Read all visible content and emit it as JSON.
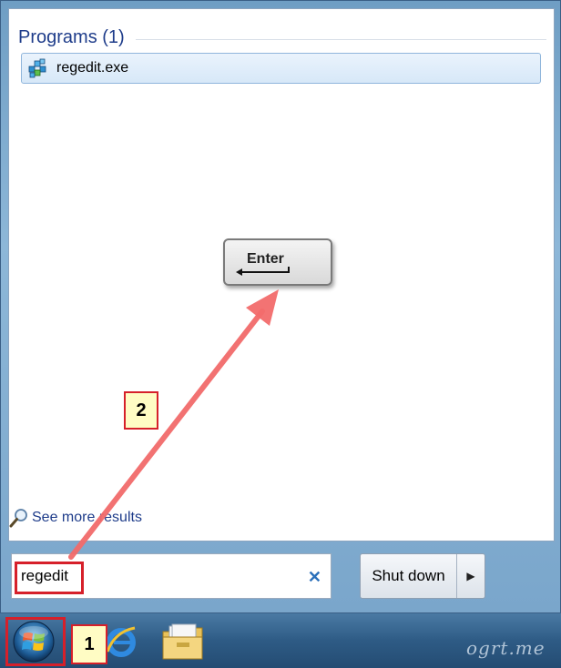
{
  "start_menu": {
    "programs_header": "Programs (1)",
    "results": [
      {
        "label": "regedit.exe",
        "icon": "registry-editor-icon"
      }
    ],
    "see_more_label": "See more results",
    "search": {
      "value": "regedit",
      "clear_icon": "clear-icon"
    },
    "shutdown": {
      "label": "Shut down",
      "arrow_icon": "triangle-right-icon"
    }
  },
  "annotations": {
    "enter_key_label": "Enter",
    "step_1": "1",
    "step_2": "2",
    "highlight_color": "#d6202a",
    "arrow_color": "#f26b6b"
  },
  "taskbar": {
    "items": [
      "windows-start-orb",
      "internet-explorer-icon",
      "windows-explorer-icon"
    ]
  },
  "watermark": "ogrt.me"
}
